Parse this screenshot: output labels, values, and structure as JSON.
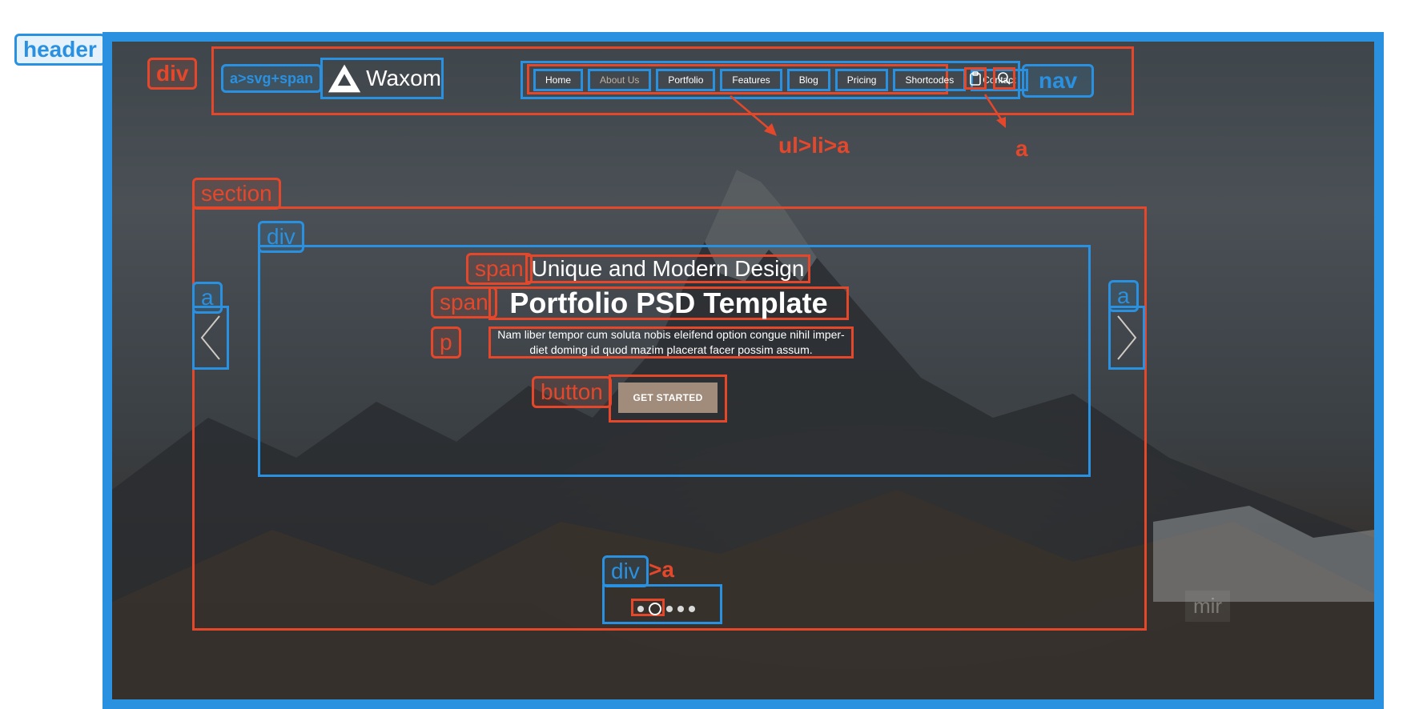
{
  "annotations": {
    "header": "header",
    "div_top": "div",
    "logo_link": "a>svg+span",
    "nav": "nav",
    "menu_arrow": "ul>li>a",
    "icons_arrow": "a",
    "section": "section",
    "inner_div": "div",
    "subtitle_span": "span",
    "title_span": "span",
    "paragraph": "p",
    "button": "button",
    "prev_link": "a",
    "next_link": "a",
    "dots_div": "div",
    "dots_suffix": ">a"
  },
  "brand": {
    "name": "Waxom"
  },
  "nav": {
    "items": [
      {
        "label": "Home",
        "active": false
      },
      {
        "label": "About Us",
        "active": true
      },
      {
        "label": "Portfolio",
        "active": false
      },
      {
        "label": "Features",
        "active": false
      },
      {
        "label": "Blog",
        "active": false
      },
      {
        "label": "Pricing",
        "active": false
      },
      {
        "label": "Shortcodes",
        "active": false
      },
      {
        "label": "Contact",
        "active": false
      }
    ],
    "icons": [
      "clipboard-icon",
      "search-icon"
    ]
  },
  "hero": {
    "subtitle": "Unique and Modern Design",
    "title": "Portfolio PSD Template",
    "paragraph_line1": "Nam liber tempor cum soluta nobis eleifend option congue nihil imper-",
    "paragraph_line2": "diet doming id quod mazim placerat facer possim assum.",
    "button": "GET STARTED"
  },
  "slider": {
    "dots": 5,
    "active_index": 1
  },
  "watermark": "mir",
  "colors": {
    "annotation_blue": "#2a90e0",
    "annotation_red": "#e5472b",
    "button": "#a18c7b",
    "active_link": "#bdb0a2"
  }
}
